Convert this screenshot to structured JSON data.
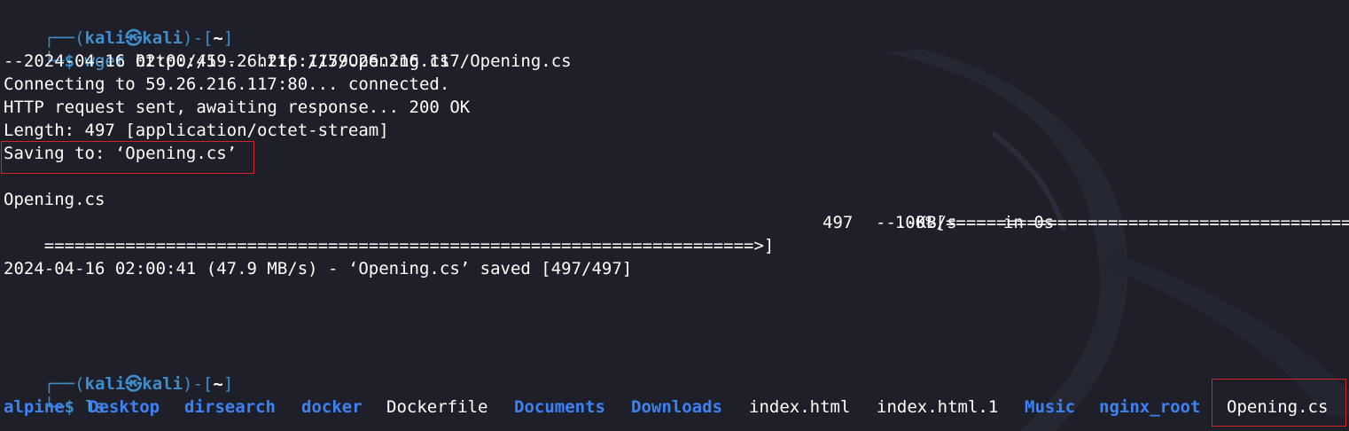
{
  "prompt": {
    "frame_top": "┌──(",
    "user_host": "kali㉿kali",
    "frame_mid": ")-[",
    "dir": "~",
    "frame_end": "]",
    "frame_bottom": "└─",
    "dollar": "$ "
  },
  "commands": {
    "wget_name": "wget",
    "wget_arg": " http://59.26.216.117/Opening.cs",
    "ls_name": "ls"
  },
  "output": {
    "line_date_url": "--2024-04-16 02:00:41--  http://59.26.216.117/Opening.cs",
    "line_connecting": "Connecting to 59.26.216.117:80... connected.",
    "line_http": "HTTP request sent, awaiting response... 200 OK",
    "line_length": "Length: 497 [application/octet-stream]",
    "line_saving": "Saving to: ‘Opening.cs’",
    "progress_filename": "Opening.cs",
    "progress_percent": "100%[",
    "progress_bar_1": "=================================================================================",
    "progress_bar_2": "======================================================================>]",
    "progress_size": "497",
    "progress_speed": "--.-KB/s",
    "progress_time": "in 0s",
    "line_saved": "2024-04-16 02:00:41 (47.9 MB/s) - ‘Opening.cs’ saved [497/497]"
  },
  "ls_items": [
    {
      "name": "alpine",
      "type": "dir"
    },
    {
      "name": "Desktop",
      "type": "dir"
    },
    {
      "name": "dirsearch",
      "type": "dir"
    },
    {
      "name": "docker",
      "type": "dir"
    },
    {
      "name": "Dockerfile",
      "type": "file"
    },
    {
      "name": "Documents",
      "type": "dir"
    },
    {
      "name": "Downloads",
      "type": "dir"
    },
    {
      "name": "index.html",
      "type": "file"
    },
    {
      "name": "index.html.1",
      "type": "file"
    },
    {
      "name": "Music",
      "type": "dir"
    },
    {
      "name": "nginx_root",
      "type": "dir"
    },
    {
      "name": "Opening.cs",
      "type": "file"
    }
  ],
  "colors": {
    "background": "#1e1f29",
    "prompt_blue": "#3f8ecb",
    "dir_blue": "#3b82f6",
    "highlight_red": "#d0262a"
  }
}
